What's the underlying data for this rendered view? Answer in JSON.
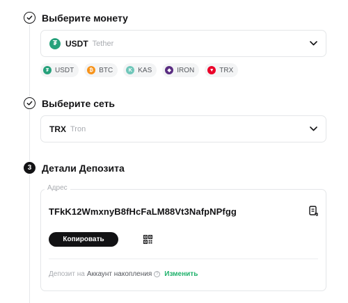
{
  "steps": {
    "coin": {
      "title": "Выберите монету"
    },
    "network": {
      "title": "Выберите сеть"
    },
    "deposit": {
      "number": "3",
      "title": "Детали Депозита"
    }
  },
  "coin_select": {
    "code": "USDT",
    "name": "Tether",
    "icon": "tether-icon",
    "color": "#26a17b"
  },
  "coin_chips": [
    {
      "code": "USDT",
      "icon": "tether-icon",
      "color": "#26a17b",
      "glyph": "₮"
    },
    {
      "code": "BTC",
      "icon": "bitcoin-icon",
      "color": "#f7931a",
      "glyph": "₿"
    },
    {
      "code": "KAS",
      "icon": "kaspa-icon",
      "color": "#70c7ba",
      "glyph": "K"
    },
    {
      "code": "IRON",
      "icon": "iron-icon",
      "color": "#5a2d82",
      "glyph": "◆"
    },
    {
      "code": "TRX",
      "icon": "tron-icon",
      "color": "#eb0029",
      "glyph": "▼"
    }
  ],
  "network_select": {
    "code": "TRX",
    "name": "Tron"
  },
  "deposit": {
    "address_label": "Адрес",
    "address": "TFkK12WmxnyB8fHcFaLM88Vt3NafpNPfgg",
    "copy_label": "Копировать",
    "deposit_to_label": "Депозит на",
    "account": "Аккаунт накопления",
    "change_label": "Изменить"
  },
  "colors": {
    "accent": "#20b26c",
    "primary": "#121214"
  }
}
